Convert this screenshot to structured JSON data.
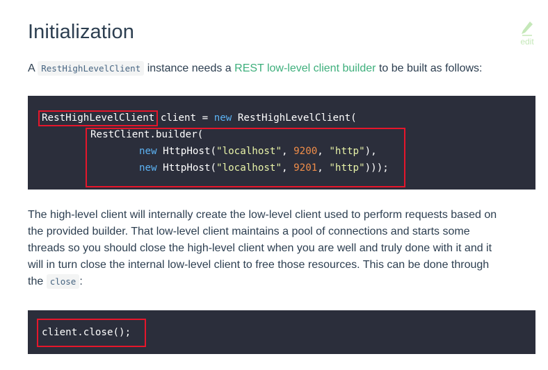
{
  "title": "Initialization",
  "edit_label": "edit",
  "intro": {
    "prefix": "A",
    "class_code": "RestHighLevelClient",
    "middle": "instance needs a",
    "link": "REST low-level client builder",
    "suffix": "to be built as follows:"
  },
  "code1": {
    "l1": {
      "cls": "RestHighLevelClient",
      "mid": " client = ",
      "kw": "new",
      "rest": " RestHighLevelClient("
    },
    "l2": {
      "text": "RestClient.builder("
    },
    "l3": {
      "kw": "new",
      "a": " HttpHost(",
      "s1": "\"localhost\"",
      "c1": ", ",
      "n": "9200",
      "c2": ", ",
      "s2": "\"http\"",
      "end": "),"
    },
    "l4": {
      "kw": "new",
      "a": " HttpHost(",
      "s1": "\"localhost\"",
      "c1": ", ",
      "n": "9201",
      "c2": ", ",
      "s2": "\"http\"",
      "end": ")));"
    }
  },
  "body": {
    "lines": [
      "The high-level client will internally create the low-level client used to perform requests based on",
      "the provided builder. That low-level client maintains a pool of connections and starts some",
      "threads so you should close the high-level client when you are well and truly done with it and it",
      "will in turn close the internal low-level client to free those resources. This can be done through"
    ],
    "last_prefix": "the",
    "last_code": "close",
    "last_suffix": ":"
  },
  "code2": {
    "text": "client.close();"
  },
  "colors": {
    "accent": "#3eaf7c",
    "highlight": "#e6162b",
    "code_bg": "#2b2e3b"
  }
}
